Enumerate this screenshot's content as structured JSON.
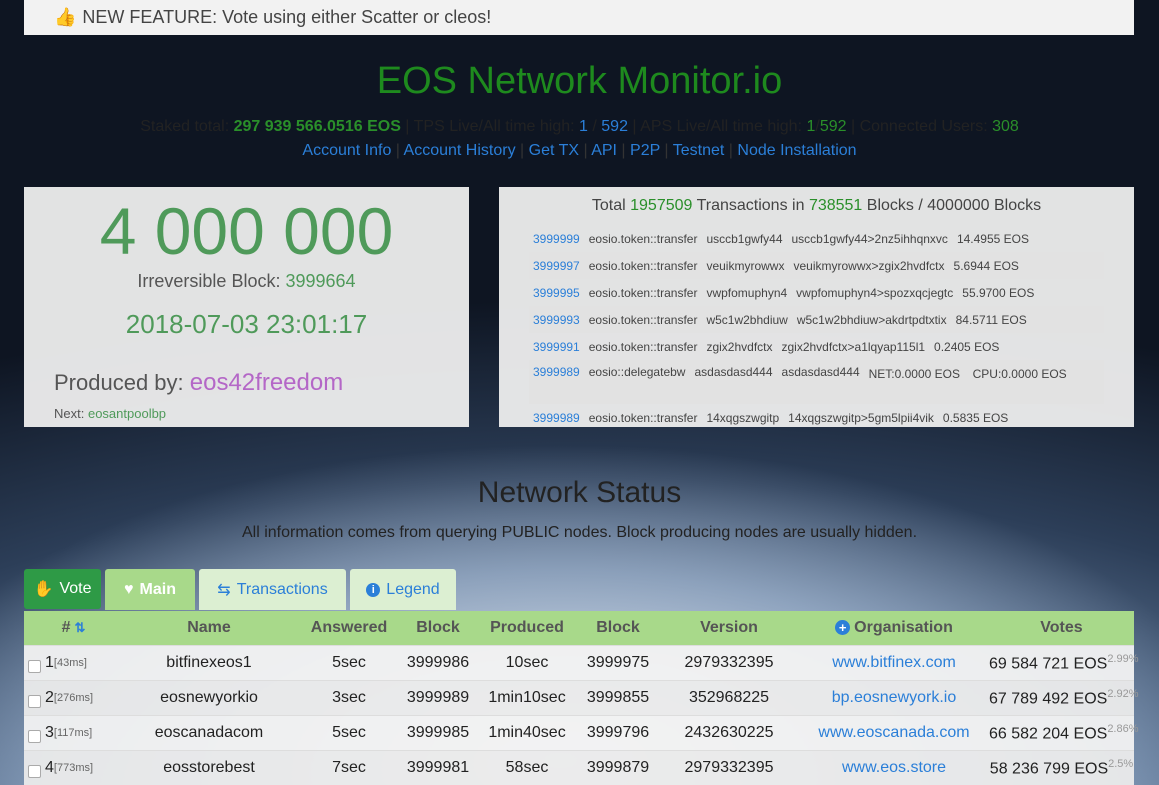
{
  "banner": {
    "icon": "thumbs-up-icon",
    "text": "NEW FEATURE: Vote using either Scatter or cleos!"
  },
  "title": "EOS Network Monitor.io",
  "stats": {
    "staked_label": "Staked total:",
    "staked_value": "297 939 566.0516 EOS",
    "tps_label": "TPS Live/All time high:",
    "tps_live": "1",
    "tps_high": "592",
    "aps_label": "APS Live/All time high:",
    "aps_live": "1",
    "aps_high": "592",
    "users_label": "Connected Users:",
    "users_value": "308"
  },
  "links": [
    "Account Info",
    "Account History",
    "Get TX",
    "API",
    "P2P",
    "Testnet",
    "Node Installation"
  ],
  "block_panel": {
    "block_number": "4 000 000",
    "irreversible_label": "Irreversible Block:",
    "irreversible_value": "3999664",
    "datetime": "2018-07-03 23:01:17",
    "produced_label": "Produced by:",
    "producer": "eos42freedom",
    "next_label": "Next:",
    "next_producer": "eosantpoolbp"
  },
  "tx_panel": {
    "head_prefix": "Total",
    "total_tx": "1957509",
    "mid": "Transactions in",
    "blocks": "738551",
    "suffix": "Blocks / 4000000 Blocks",
    "rows": [
      {
        "block": "3999999",
        "action": "eosio.token::transfer",
        "from": "usccb1gwfy44",
        "memo": "usccb1gwfy44>2nz5ihhqnxvc",
        "amount": "14.4955 EOS"
      },
      {
        "block": "3999997",
        "action": "eosio.token::transfer",
        "from": "veuikmyrowwx",
        "memo": "veuikmyrowwx>zgix2hvdfctx",
        "amount": "5.6944 EOS"
      },
      {
        "block": "3999995",
        "action": "eosio.token::transfer",
        "from": "vwpfomuphyn4",
        "memo": "vwpfomuphyn4>spozxqcjegtc",
        "amount": "55.9700 EOS"
      },
      {
        "block": "3999993",
        "action": "eosio.token::transfer",
        "from": "w5c1w2bhdiuw",
        "memo": "w5c1w2bhdiuw>akdrtpdtxtix",
        "amount": "84.5711 EOS"
      },
      {
        "block": "3999991",
        "action": "eosio.token::transfer",
        "from": "zgix2hvdfctx",
        "memo": "zgix2hvdfctx>a1lqyap115l1",
        "amount": "0.2405 EOS"
      }
    ],
    "delegate_row": {
      "block": "3999989",
      "action": "eosio::delegatebw",
      "from": "asdasdasd444",
      "to": "asdasdasd444",
      "net": "NET:0.0000 EOS",
      "cpu": "CPU:0.0000 EOS"
    },
    "last_row": {
      "block": "3999989",
      "action": "eosio.token::transfer",
      "from": "14xqgszwgitp",
      "memo": "14xqgszwgitp>5gm5lpii4vik",
      "amount": "0.5835 EOS"
    }
  },
  "network_status": {
    "title": "Network Status",
    "subtitle": "All information comes from querying PUBLIC nodes. Block producing nodes are usually hidden."
  },
  "tabs": {
    "vote": "Vote",
    "main": "Main",
    "transactions": "Transactions",
    "legend": "Legend"
  },
  "table": {
    "headers": [
      "#",
      "Name",
      "Answered",
      "Block",
      "Produced",
      "Block",
      "Version",
      "Organisation",
      "Votes"
    ],
    "rows": [
      {
        "rank": "1",
        "ping": "[43ms]",
        "name": "bitfinexeos1",
        "answered": "5sec",
        "block": "3999986",
        "produced": "10sec",
        "block2": "3999975",
        "version": "2979332395",
        "org": "www.bitfinex.com",
        "votes": "69 584 721 EOS",
        "pct": "2.99%"
      },
      {
        "rank": "2",
        "ping": "[276ms]",
        "name": "eosnewyorkio",
        "answered": "3sec",
        "block": "3999989",
        "produced": "1min10sec",
        "block2": "3999855",
        "version": "352968225",
        "org": "bp.eosnewyork.io",
        "votes": "67 789 492 EOS",
        "pct": "2.92%"
      },
      {
        "rank": "3",
        "ping": "[117ms]",
        "name": "eoscanadacom",
        "answered": "5sec",
        "block": "3999985",
        "produced": "1min40sec",
        "block2": "3999796",
        "version": "2432630225",
        "org": "www.eoscanada.com",
        "votes": "66 582 204 EOS",
        "pct": "2.86%"
      },
      {
        "rank": "4",
        "ping": "[773ms]",
        "name": "eosstorebest",
        "answered": "7sec",
        "block": "3999981",
        "produced": "58sec",
        "block2": "3999879",
        "version": "2979332395",
        "org": "www.eos.store",
        "votes": "58 236 799 EOS",
        "pct": "2.5%"
      }
    ]
  }
}
